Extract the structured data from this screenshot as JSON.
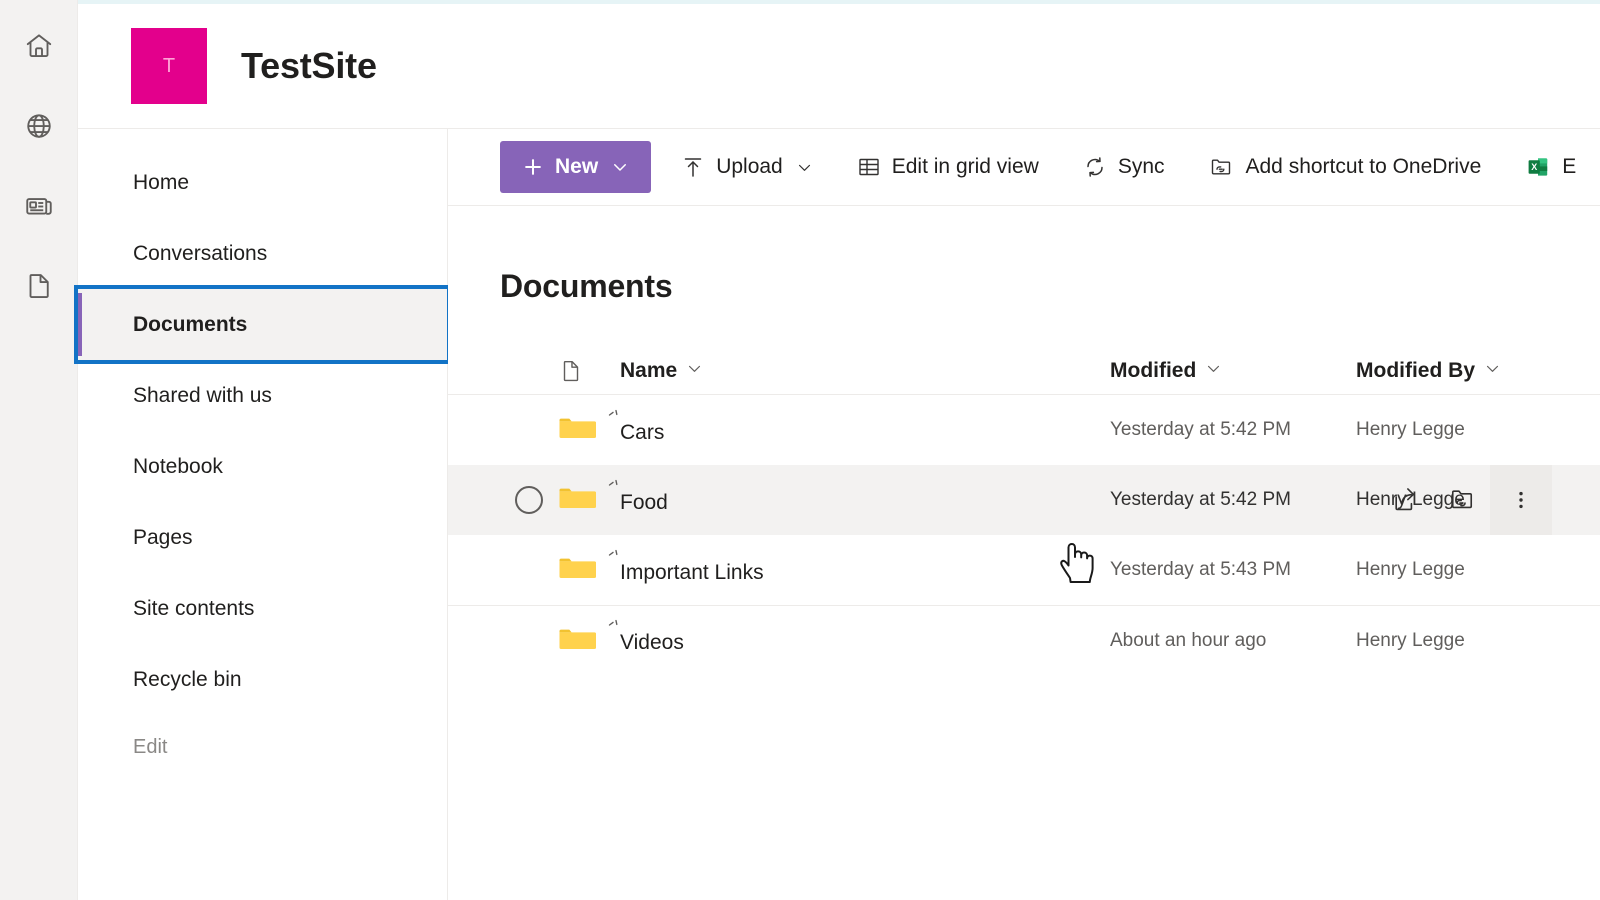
{
  "rail": {
    "items": [
      {
        "name": "home-icon",
        "label": "Home"
      },
      {
        "name": "globe-icon",
        "label": "My sites"
      },
      {
        "name": "news-icon",
        "label": "News"
      },
      {
        "name": "document-icon",
        "label": "Files"
      }
    ]
  },
  "site": {
    "logo_letter": "T",
    "logo_color": "#E3008C",
    "title": "TestSite"
  },
  "nav": {
    "items": [
      {
        "label": "Home",
        "selected": false
      },
      {
        "label": "Conversations",
        "selected": false
      },
      {
        "label": "Documents",
        "selected": true
      },
      {
        "label": "Shared with us",
        "selected": false
      },
      {
        "label": "Notebook",
        "selected": false
      },
      {
        "label": "Pages",
        "selected": false
      },
      {
        "label": "Site contents",
        "selected": false
      },
      {
        "label": "Recycle bin",
        "selected": false
      }
    ],
    "edit_label": "Edit",
    "focus_color": "#1273C6",
    "accent_color": "#8764B8"
  },
  "commandbar": {
    "new_label": "New",
    "new_color": "#8764B8",
    "items": [
      {
        "label": "Upload",
        "icon": "upload-icon",
        "has_chevron": true
      },
      {
        "label": "Edit in grid view",
        "icon": "grid-icon",
        "has_chevron": false
      },
      {
        "label": "Sync",
        "icon": "sync-icon",
        "has_chevron": false
      },
      {
        "label": "Add shortcut to OneDrive",
        "icon": "add-shortcut-icon",
        "has_chevron": false
      },
      {
        "label": "E",
        "icon": "excel-icon",
        "has_chevron": false
      }
    ]
  },
  "main": {
    "page_title": "Documents",
    "columns": [
      {
        "key": "name",
        "label": "Name"
      },
      {
        "key": "modified",
        "label": "Modified"
      },
      {
        "key": "modified_by",
        "label": "Modified By"
      }
    ],
    "rows": [
      {
        "name": "Cars",
        "modified": "Yesterday at 5:42 PM",
        "modified_by": "Henry Legge",
        "is_folder": true,
        "is_new": true,
        "hovered": false
      },
      {
        "name": "Food",
        "modified": "Yesterday at 5:42 PM",
        "modified_by": "Henry Legge",
        "is_folder": true,
        "is_new": true,
        "hovered": true
      },
      {
        "name": "Important Links",
        "modified": "Yesterday at 5:43 PM",
        "modified_by": "Henry Legge",
        "is_folder": true,
        "is_new": true,
        "hovered": false
      },
      {
        "name": "Videos",
        "modified": "About an hour ago",
        "modified_by": "Henry Legge",
        "is_folder": true,
        "is_new": true,
        "hovered": false
      }
    ],
    "row_actions": [
      {
        "name": "share-icon",
        "label": "Share"
      },
      {
        "name": "copy-link-icon",
        "label": "Copy link"
      },
      {
        "name": "more-options-icon",
        "label": "More options"
      }
    ]
  },
  "colors": {
    "folder": "#FFD24D",
    "folder_tab": "#F2C230",
    "hover_row": "#F3F2F1",
    "divider": "#EDEBE9"
  }
}
